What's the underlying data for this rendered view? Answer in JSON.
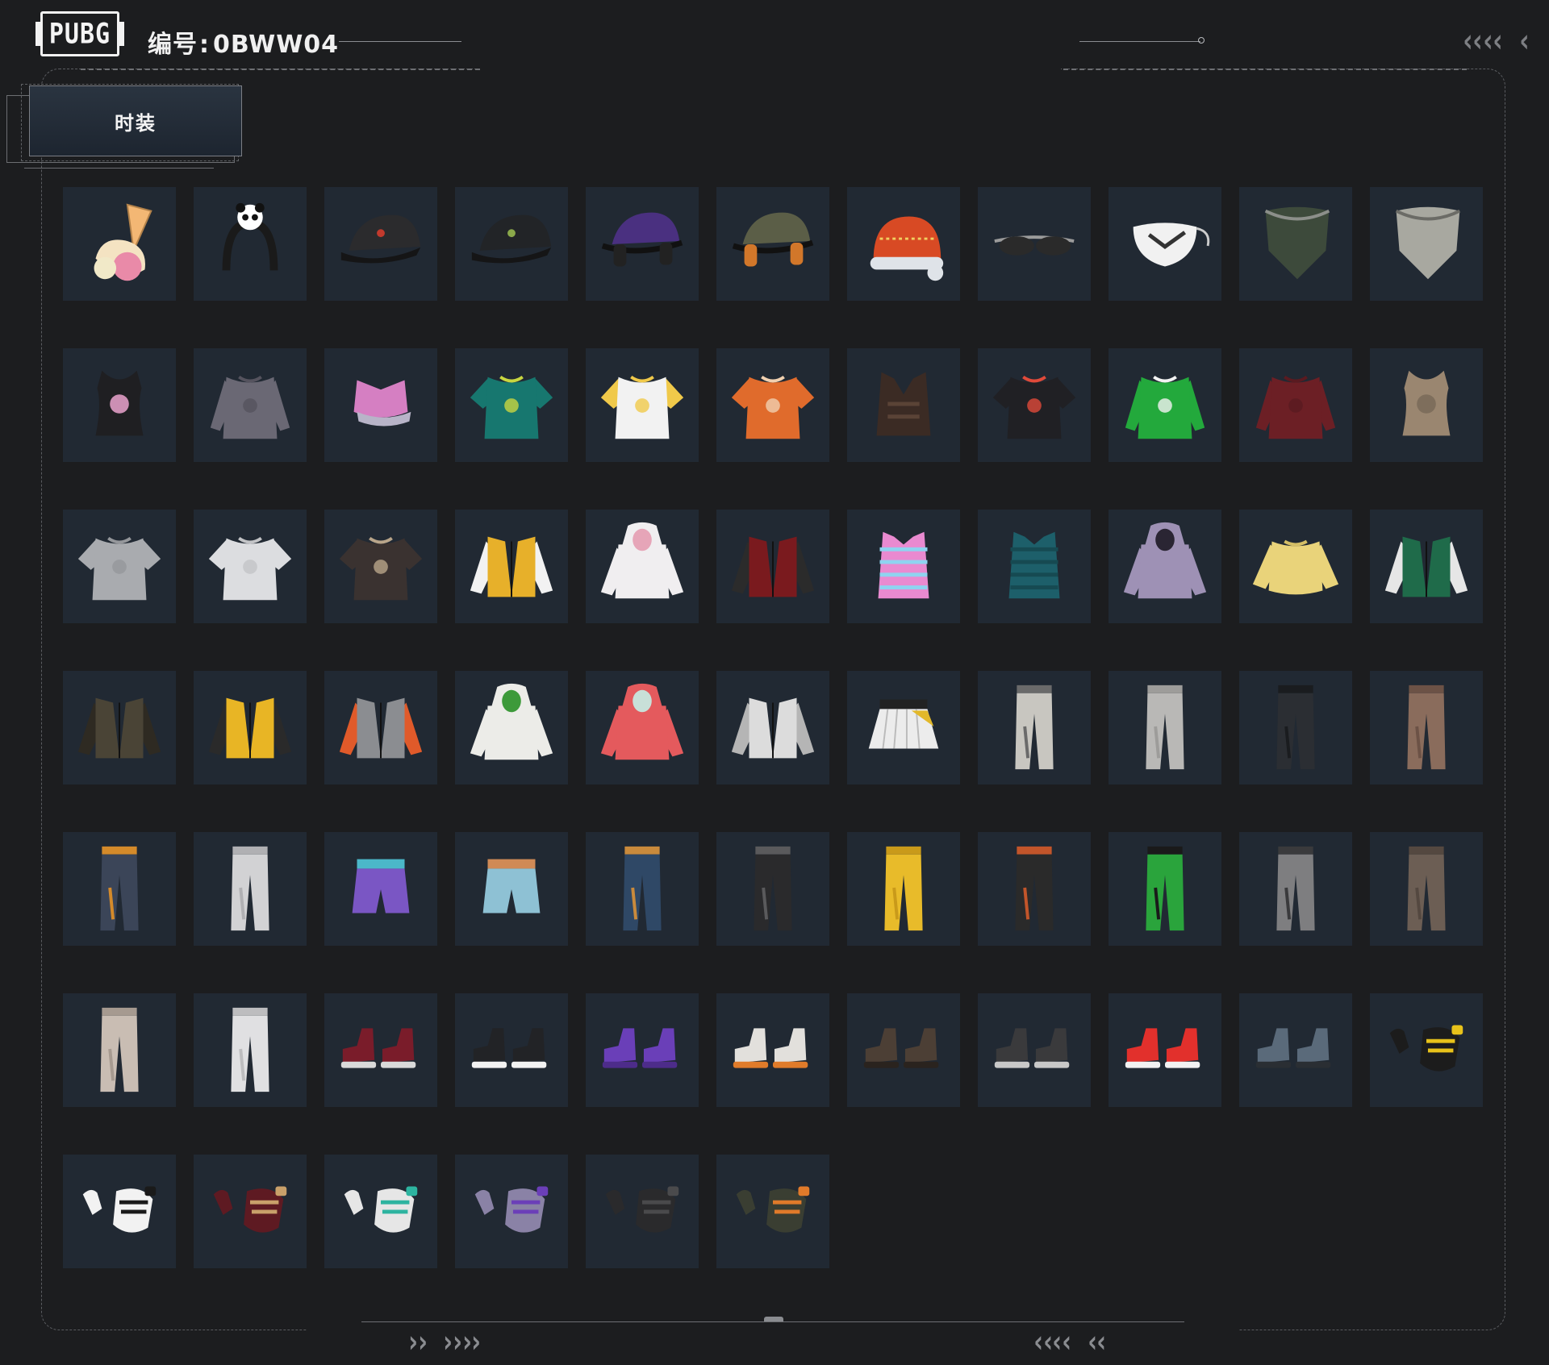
{
  "header": {
    "logo_text": "PUBG",
    "id_label": "编号",
    "id_separator": ":",
    "id_value": "0BWW04"
  },
  "category_tab": {
    "label": "时装"
  },
  "colors": {
    "background": "#1c1d1f",
    "tile": "#212933",
    "frame_line": "#6d6f73",
    "text": "#f0f0f0"
  },
  "items": [
    {
      "kind": "icecream",
      "color": "#f3b774",
      "accent": "#e98aa8",
      "name": "ice-cream-headwear"
    },
    {
      "kind": "headband",
      "color": "#1a1a1a",
      "accent": "#ffffff",
      "name": "panda-headband"
    },
    {
      "kind": "cap",
      "color": "#2b2b2d",
      "accent": "#c23a2d",
      "name": "black-cap-red-logo"
    },
    {
      "kind": "cap",
      "color": "#222427",
      "accent": "#8aa84a",
      "name": "black-cap-green-logo"
    },
    {
      "kind": "capphones",
      "color": "#4a3080",
      "accent": "#222",
      "name": "purple-cap-headphones"
    },
    {
      "kind": "capphones",
      "color": "#5b5e47",
      "accent": "#d2772a",
      "name": "olive-cap-headset"
    },
    {
      "kind": "beanie",
      "color": "#d84a24",
      "accent": "#dfe3e8",
      "name": "festive-beanie"
    },
    {
      "kind": "glasses",
      "color": "#2a2a2a",
      "accent": "#9b9b9b",
      "name": "sunglasses"
    },
    {
      "kind": "mask",
      "color": "#f1f1f1",
      "accent": "#333",
      "name": "face-mask"
    },
    {
      "kind": "bandana",
      "color": "#3d4a3b",
      "accent": "#8c8f8a",
      "name": "camo-bandana"
    },
    {
      "kind": "bandana",
      "color": "#a8a8a0",
      "accent": "#6b6b66",
      "name": "checkered-bandana"
    },
    {
      "kind": "tank",
      "color": "#1f1f22",
      "accent": "#cc8fb4",
      "name": "black-tank-top"
    },
    {
      "kind": "shirt",
      "color": "#6a6874",
      "accent": "#55535e",
      "name": "grey-shirt"
    },
    {
      "kind": "crop",
      "color": "#d57fc2",
      "accent": "#b8b4c8",
      "name": "pink-crop-top"
    },
    {
      "kind": "polo",
      "color": "#17776f",
      "accent": "#c9d640",
      "name": "teal-polo"
    },
    {
      "kind": "tee",
      "color": "#f2f2f2",
      "accent": "#f0c94a",
      "name": "raglan-tee"
    },
    {
      "kind": "tee",
      "color": "#e06b2c",
      "accent": "#f0d0b0",
      "name": "orange-tee"
    },
    {
      "kind": "vest",
      "color": "#3b2b24",
      "accent": "#5a4336",
      "name": "leather-vest"
    },
    {
      "kind": "tee",
      "color": "#202024",
      "accent": "#e04a3a",
      "name": "graphic-tee"
    },
    {
      "kind": "long",
      "color": "#23a93c",
      "accent": "#f2f2f2",
      "name": "green-jersey"
    },
    {
      "kind": "long",
      "color": "#6c1f25",
      "accent": "#5a1a20",
      "name": "maroon-turtleneck"
    },
    {
      "kind": "tank",
      "color": "#9a8670",
      "accent": "#7e6e5c",
      "name": "worn-tank-top"
    },
    {
      "kind": "tee",
      "color": "#a9abaf",
      "accent": "#95979b",
      "name": "grey-tee"
    },
    {
      "kind": "tee",
      "color": "#dcdde0",
      "accent": "#c3c4c7",
      "name": "white-tee"
    },
    {
      "kind": "tee",
      "color": "#3a3230",
      "accent": "#b9a58a",
      "name": "winner-tee"
    },
    {
      "kind": "jacket",
      "color": "#e7b02a",
      "accent": "#f2f2f2",
      "name": "yellow-white-jacket"
    },
    {
      "kind": "hoodie",
      "color": "#f0eef0",
      "accent": "#e6a5b8",
      "name": "pink-white-hoodie"
    },
    {
      "kind": "jacket",
      "color": "#7a1a1e",
      "accent": "#2b2b2b",
      "name": "red-leather-jacket"
    },
    {
      "kind": "puffer",
      "color": "#e98ad0",
      "accent": "#8fd3f0",
      "name": "holo-puffer-vest"
    },
    {
      "kind": "puffer",
      "color": "#1d5f6a",
      "accent": "#164a52",
      "name": "teal-puffer-vest"
    },
    {
      "kind": "hoodie",
      "color": "#9e91b5",
      "accent": "#2a2533",
      "name": "lilac-hoodie"
    },
    {
      "kind": "sweater",
      "color": "#e9d37a",
      "accent": "#d4be66",
      "name": "yellow-sweater"
    },
    {
      "kind": "jacket",
      "color": "#1f6b4a",
      "accent": "#e6e6e6",
      "name": "varsity-jacket"
    },
    {
      "kind": "jacket",
      "color": "#4a4436",
      "accent": "#2e2a22",
      "name": "camo-leather-jacket"
    },
    {
      "kind": "jacket",
      "color": "#e8b525",
      "accent": "#2a2a2a",
      "name": "yellow-rain-jacket"
    },
    {
      "kind": "jacket",
      "color": "#8b8d91",
      "accent": "#e05a2a",
      "name": "grey-orange-jacket"
    },
    {
      "kind": "hoodie",
      "color": "#ecece8",
      "accent": "#3d9a3a",
      "name": "white-green-hoodie"
    },
    {
      "kind": "hoodie",
      "color": "#e45a5d",
      "accent": "#c8e0d8",
      "name": "red-hoodie"
    },
    {
      "kind": "jacket",
      "color": "#dcdcdc",
      "accent": "#b5b5b5",
      "name": "white-blazer"
    },
    {
      "kind": "skirt",
      "color": "#ececec",
      "accent": "#e2b82a",
      "name": "pleated-skirt"
    },
    {
      "kind": "pants",
      "color": "#c8c6c0",
      "accent": "#6a6a6a",
      "name": "plaid-pants"
    },
    {
      "kind": "pants",
      "color": "#b9b8b6",
      "accent": "#9d9c9a",
      "name": "flared-pants"
    },
    {
      "kind": "pants",
      "color": "#2b2e33",
      "accent": "#1a1c1f",
      "name": "tactical-pants"
    },
    {
      "kind": "pants",
      "color": "#8a6c5c",
      "accent": "#6c5246",
      "name": "brown-leggings"
    },
    {
      "kind": "pants",
      "color": "#3b4558",
      "accent": "#d48a2a",
      "name": "sunflower-jeans"
    },
    {
      "kind": "pants",
      "color": "#d2d2d4",
      "accent": "#b0b0b3",
      "name": "white-joggers"
    },
    {
      "kind": "shorts",
      "color": "#7a56c4",
      "accent": "#4bb7c9",
      "name": "gradient-cargo-shorts"
    },
    {
      "kind": "shorts",
      "color": "#8ec1d4",
      "accent": "#d08a56",
      "name": "light-blue-shorts"
    },
    {
      "kind": "pants",
      "color": "#2f4866",
      "accent": "#c98a3c",
      "name": "blue-jeans"
    },
    {
      "kind": "pants",
      "color": "#2a2a2c",
      "accent": "#5a5a5c",
      "name": "black-ripped-jeans"
    },
    {
      "kind": "pants",
      "color": "#e8bb2a",
      "accent": "#c99a1a",
      "name": "yellow-track-pants"
    },
    {
      "kind": "pants",
      "color": "#2a2a2a",
      "accent": "#c2552a",
      "name": "black-cargo-pants"
    },
    {
      "kind": "pants",
      "color": "#2aa43c",
      "accent": "#1a1a1a",
      "name": "green-moto-pants"
    },
    {
      "kind": "pants",
      "color": "#7e7e80",
      "accent": "#3a3a3c",
      "name": "camo-pants"
    },
    {
      "kind": "pants",
      "color": "#6c5e54",
      "accent": "#544840",
      "name": "brown-slim-pants"
    },
    {
      "kind": "pants",
      "color": "#c9bdb3",
      "accent": "#a69a90",
      "name": "beige-leggings"
    },
    {
      "kind": "boots",
      "color": "#e0e0e2",
      "accent": "#bdbdbf",
      "name": "white-tights"
    },
    {
      "kind": "shoes",
      "color": "#7a1c2a",
      "accent": "#d9d9d9",
      "name": "red-high-boots"
    },
    {
      "kind": "shoes",
      "color": "#222326",
      "accent": "#f2f2f2",
      "name": "black-sneakers"
    },
    {
      "kind": "shoes",
      "color": "#6a3fb8",
      "accent": "#4d2c8a",
      "name": "purple-boots"
    },
    {
      "kind": "shoes",
      "color": "#e2e0dc",
      "accent": "#e07b2a",
      "name": "white-sneakers"
    },
    {
      "kind": "shoes",
      "color": "#4c3f35",
      "accent": "#2a231e",
      "name": "brown-boots"
    },
    {
      "kind": "shoes",
      "color": "#3a3a3c",
      "accent": "#c8c8c8",
      "name": "grey-sock-shoes"
    },
    {
      "kind": "shoes",
      "color": "#e2302c",
      "accent": "#f2f2f2",
      "name": "red-sneakers"
    },
    {
      "kind": "shoes",
      "color": "#5a6a7a",
      "accent": "#2a2e33",
      "name": "camo-boots"
    },
    {
      "kind": "gloves",
      "color": "#1c1c1c",
      "accent": "#e8c21a",
      "name": "black-yellow-gloves"
    },
    {
      "kind": "gloves",
      "color": "#f2f2f2",
      "accent": "#1a1a1a",
      "name": "panda-gloves"
    },
    {
      "kind": "gloves",
      "color": "#5e1a22",
      "accent": "#c9a06a",
      "name": "red-mech-gloves"
    },
    {
      "kind": "gloves",
      "color": "#e6e6e6",
      "accent": "#2db4a0",
      "name": "white-teal-gloves"
    },
    {
      "kind": "gloves",
      "color": "#8a82a6",
      "accent": "#6b3fb8",
      "name": "purple-grey-gloves"
    },
    {
      "kind": "gloves",
      "color": "#2a2a2c",
      "accent": "#4a4a4c",
      "name": "black-fingerless-gloves"
    },
    {
      "kind": "gloves",
      "color": "#3a3e32",
      "accent": "#e07a2a",
      "name": "camo-tactical-gloves"
    }
  ]
}
